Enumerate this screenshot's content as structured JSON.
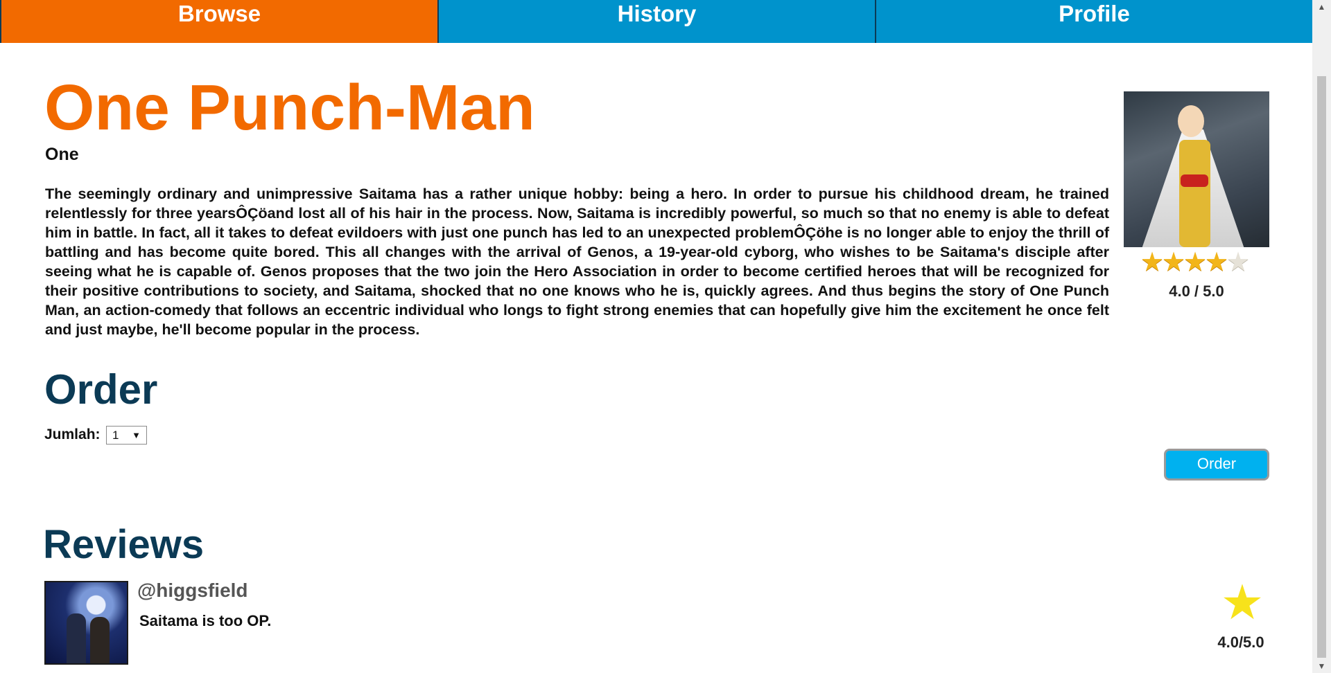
{
  "nav": {
    "tabs": [
      {
        "label": "Browse",
        "active": true
      },
      {
        "label": "History",
        "active": false
      },
      {
        "label": "Profile",
        "active": false
      }
    ]
  },
  "book": {
    "title": "One Punch-Man",
    "author": "One",
    "synopsis": "The seemingly ordinary and unimpressive Saitama has a rather unique hobby: being a hero. In order to pursue his childhood dream, he trained relentlessly for three yearsÔÇöand lost all of his hair in the process. Now, Saitama is incredibly powerful, so much so that no enemy is able to defeat him in battle. In fact, all it takes to defeat evildoers with just one punch has led to an unexpected problemÔÇöhe is no longer able to enjoy the thrill of battling and has become quite bored. This all changes with the arrival of Genos, a 19-year-old cyborg, who wishes to be Saitama's disciple after seeing what he is capable of. Genos proposes that the two join the Hero Association in order to become certified heroes that will be recognized for their positive contributions to society, and Saitama, shocked that no one knows who he is, quickly agrees. And thus begins the story of One Punch Man, an action-comedy that follows an eccentric individual who longs to fight strong enemies that can hopefully give him the excitement he once felt and just maybe, he'll become popular in the process.",
    "rating": {
      "stars_filled": 4,
      "stars_total": 5,
      "text": "4.0 / 5.0"
    }
  },
  "order": {
    "heading": "Order",
    "quantity_label": "Jumlah:",
    "quantity_value": "1",
    "button_label": "Order"
  },
  "reviews": {
    "heading": "Reviews",
    "items": [
      {
        "user": "@higgsfield",
        "text": "Saitama is too OP.",
        "score": "4.0/5.0"
      }
    ]
  },
  "colors": {
    "accent_orange": "#f26a00",
    "nav_blue": "#0093cc",
    "heading_navy": "#0b3a55",
    "button_blue": "#00b1ef",
    "star_gold": "#f2b51a"
  }
}
